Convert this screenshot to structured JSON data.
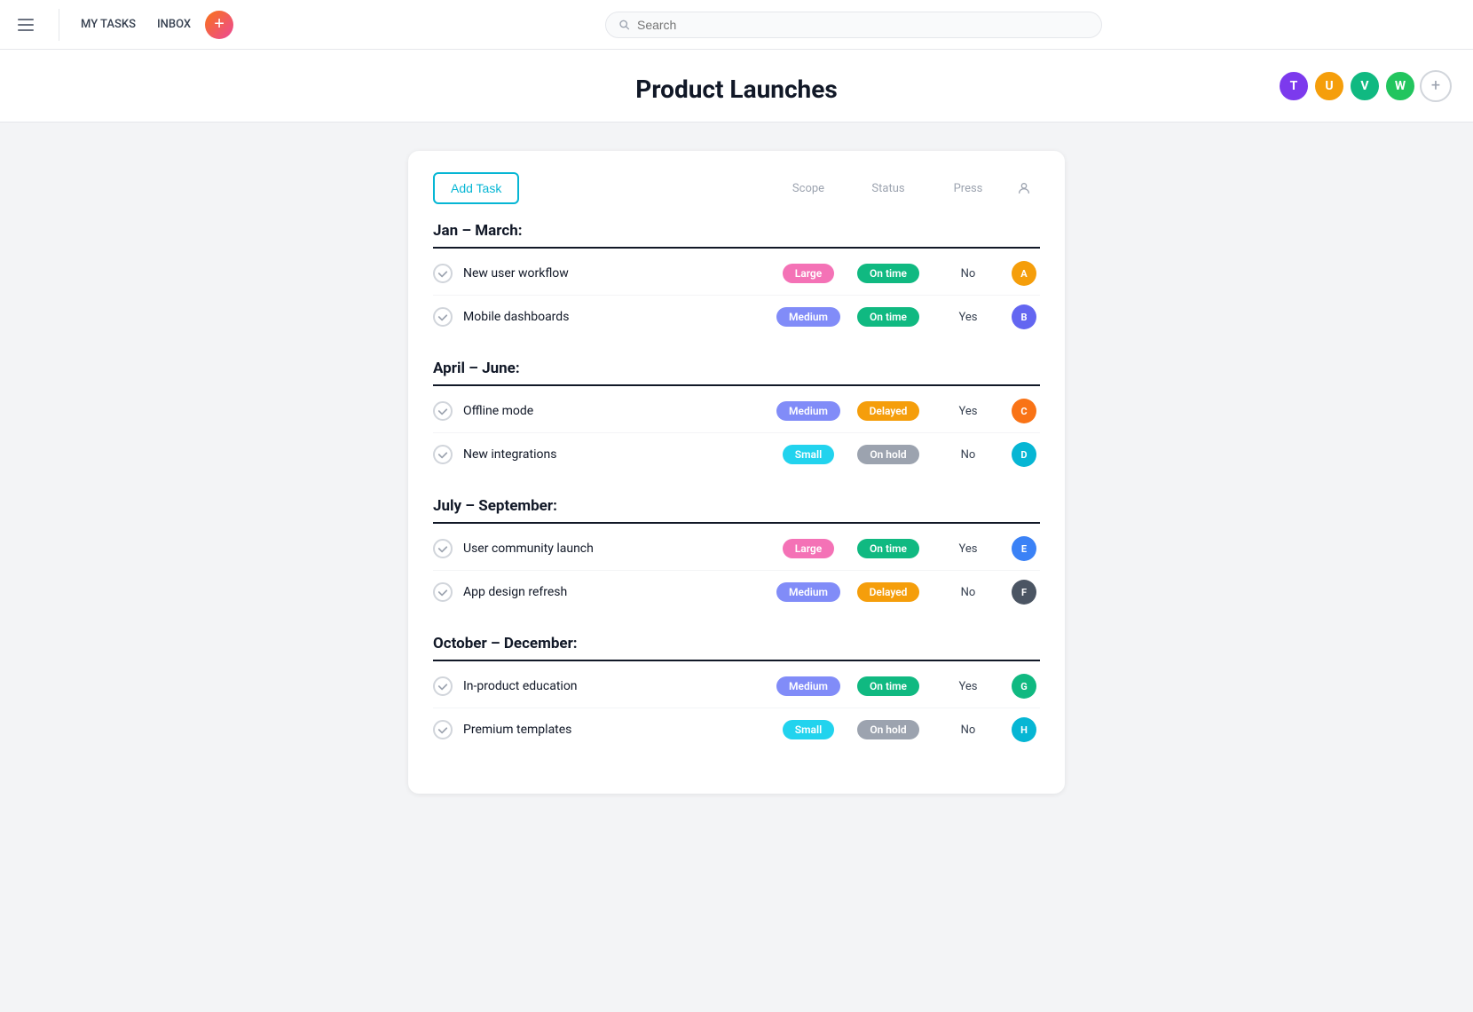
{
  "nav": {
    "my_tasks": "MY TASKS",
    "inbox": "INBOX",
    "search_placeholder": "Search"
  },
  "page": {
    "title": "Product Launches"
  },
  "toolbar": {
    "add_task_label": "Add Task",
    "col_scope": "Scope",
    "col_status": "Status",
    "col_press": "Press"
  },
  "sections": [
    {
      "id": "jan-march",
      "title": "Jan – March:",
      "tasks": [
        {
          "name": "New user workflow",
          "scope": "Large",
          "scope_type": "large",
          "status": "On time",
          "status_type": "on-time",
          "press": "No",
          "avatar_color": "#f59e0b",
          "avatar_letter": "A"
        },
        {
          "name": "Mobile dashboards",
          "scope": "Medium",
          "scope_type": "medium",
          "status": "On time",
          "status_type": "on-time",
          "press": "Yes",
          "avatar_color": "#6366f1",
          "avatar_letter": "B"
        }
      ]
    },
    {
      "id": "april-june",
      "title": "April – June:",
      "tasks": [
        {
          "name": "Offline mode",
          "scope": "Medium",
          "scope_type": "medium",
          "status": "Delayed",
          "status_type": "delayed",
          "press": "Yes",
          "avatar_color": "#f97316",
          "avatar_letter": "C"
        },
        {
          "name": "New integrations",
          "scope": "Small",
          "scope_type": "small",
          "status": "On hold",
          "status_type": "on-hold",
          "press": "No",
          "avatar_color": "#06b6d4",
          "avatar_letter": "D"
        }
      ]
    },
    {
      "id": "july-september",
      "title": "July – September:",
      "tasks": [
        {
          "name": "User community launch",
          "scope": "Large",
          "scope_type": "large",
          "status": "On time",
          "status_type": "on-time",
          "press": "Yes",
          "avatar_color": "#3b82f6",
          "avatar_letter": "E"
        },
        {
          "name": "App design refresh",
          "scope": "Medium",
          "scope_type": "medium",
          "status": "Delayed",
          "status_type": "delayed",
          "press": "No",
          "avatar_color": "#4b5563",
          "avatar_letter": "F"
        }
      ]
    },
    {
      "id": "october-december",
      "title": "October – December:",
      "tasks": [
        {
          "name": "In-product education",
          "scope": "Medium",
          "scope_type": "medium",
          "status": "On time",
          "status_type": "on-time",
          "press": "Yes",
          "avatar_color": "#10b981",
          "avatar_letter": "G"
        },
        {
          "name": "Premium templates",
          "scope": "Small",
          "scope_type": "small",
          "status": "On hold",
          "status_type": "on-hold",
          "press": "No",
          "avatar_color": "#06b6d4",
          "avatar_letter": "H"
        }
      ]
    }
  ],
  "team_avatars": [
    {
      "color": "#7c3aed",
      "letter": "T"
    },
    {
      "color": "#f59e0b",
      "letter": "U"
    },
    {
      "color": "#10b981",
      "letter": "V"
    },
    {
      "color": "#22c55e",
      "letter": "W"
    }
  ]
}
